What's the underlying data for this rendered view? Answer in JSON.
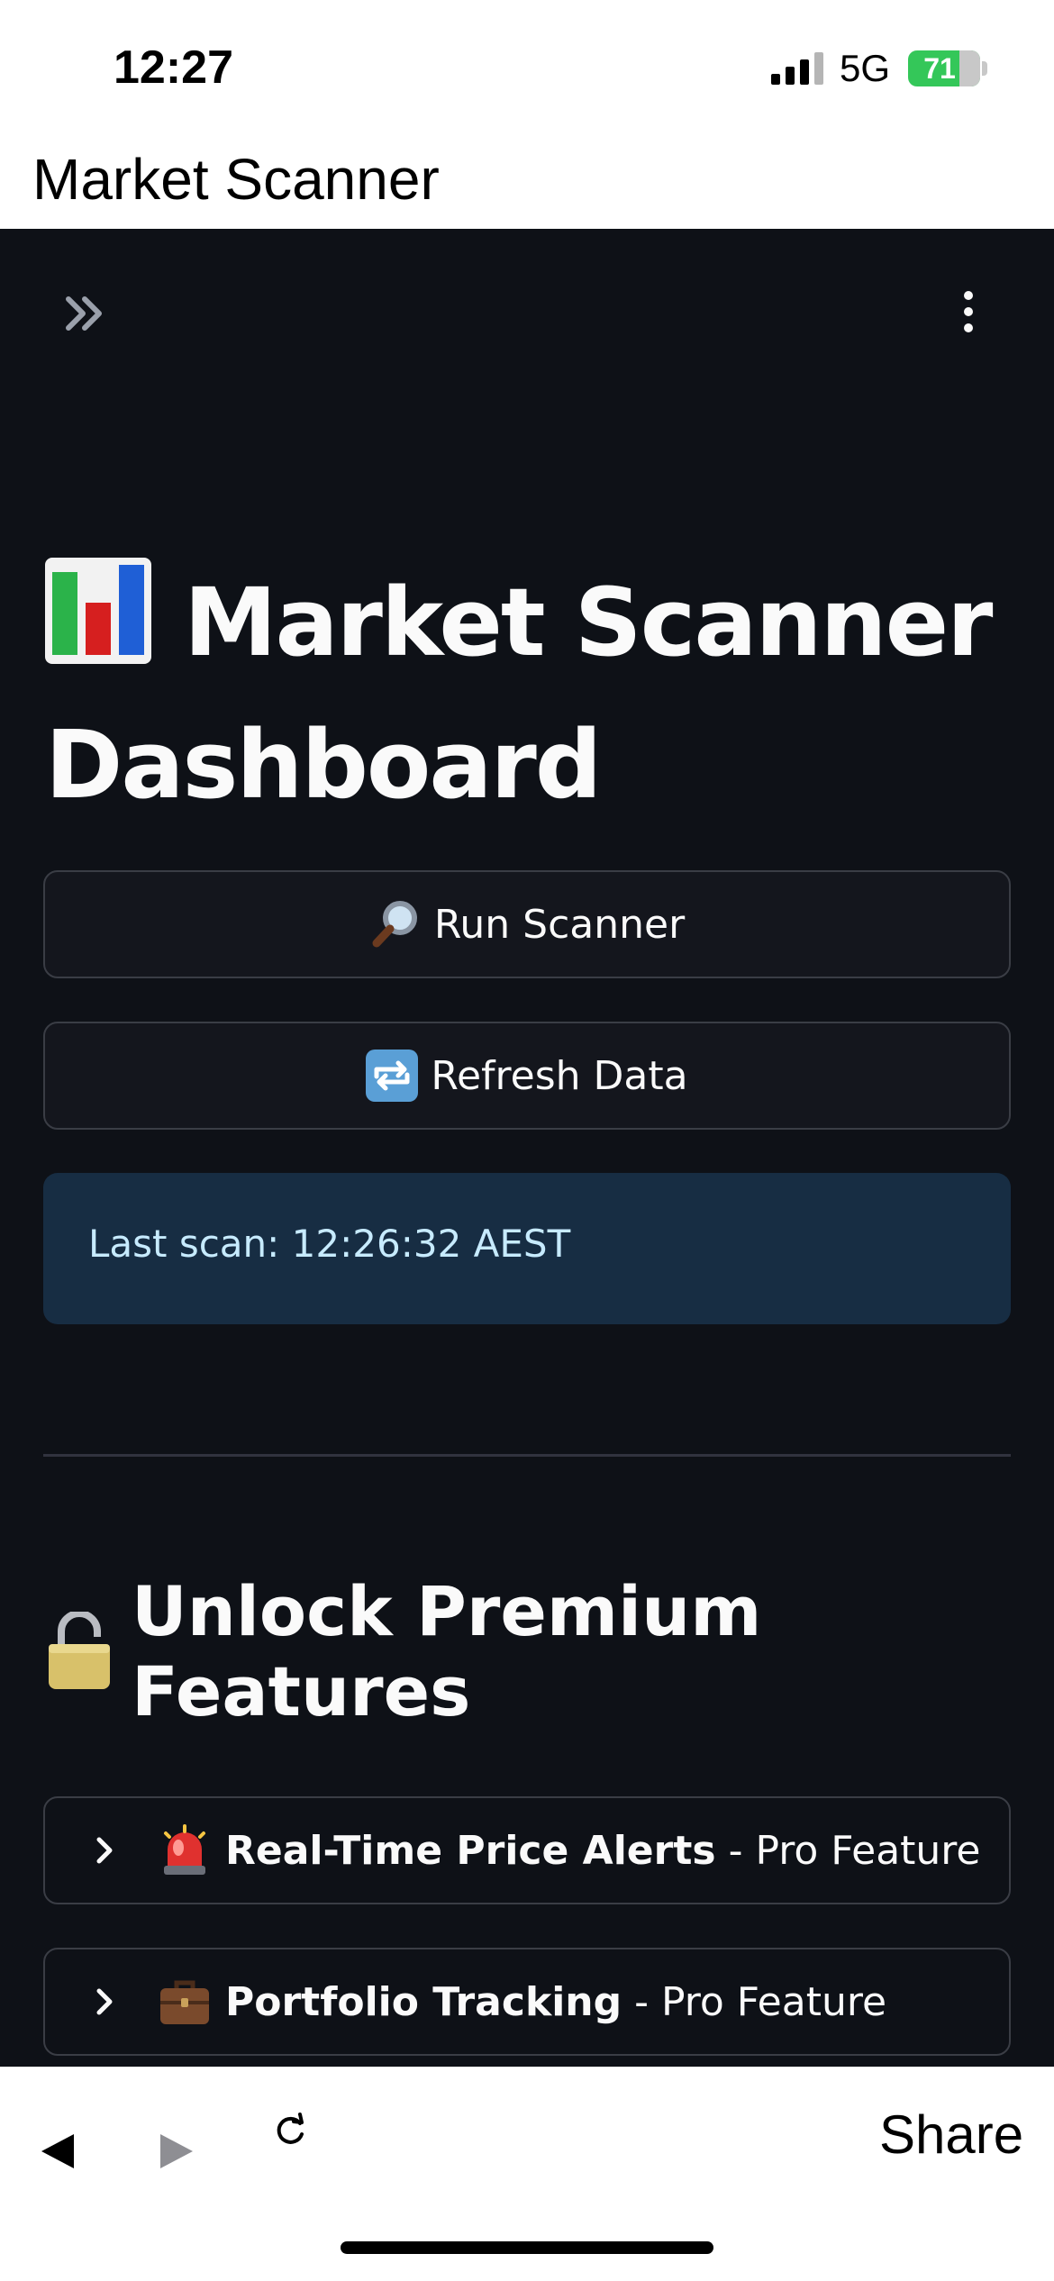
{
  "status_bar": {
    "time": "12:27",
    "network": "5G",
    "battery": "71",
    "battery_level": 0.71
  },
  "browser": {
    "page_title": "Market Scanner",
    "share_label": "Share"
  },
  "app": {
    "title": "Market Scanner Dashboard",
    "title_icon": "bar-chart-icon",
    "buttons": [
      {
        "icon": "magnifying-glass-icon",
        "label": "Run Scanner"
      },
      {
        "icon": "repeat-icon",
        "label": "Refresh Data"
      }
    ],
    "info": "Last scan: 12:26:32 AEST",
    "premium": {
      "icon": "lock-icon",
      "title": "Unlock Premium Features",
      "items": [
        {
          "icon": "siren-icon",
          "title": "Real-Time Price Alerts",
          "suffix": "- Pro Feature"
        },
        {
          "icon": "briefcase-icon",
          "title": "Portfolio Tracking",
          "suffix": "- Pro Feature"
        }
      ]
    }
  },
  "colors": {
    "app_background": "#0e1117",
    "text": "#fafafa",
    "info_background": "#172d43",
    "info_text": "#c7ebff",
    "border": "#3a3d45"
  }
}
